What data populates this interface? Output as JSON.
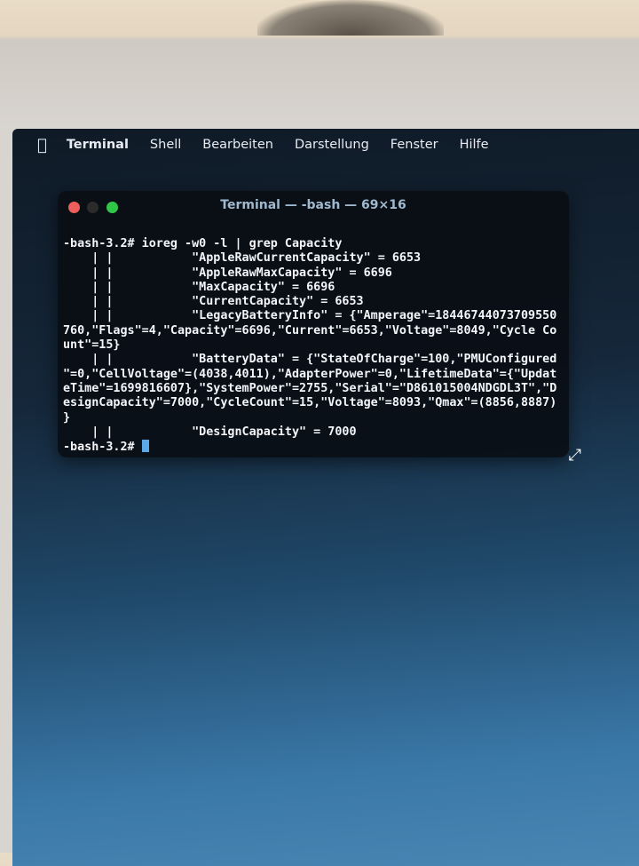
{
  "menubar": {
    "items": [
      "Terminal",
      "Shell",
      "Bearbeiten",
      "Darstellung",
      "Fenster",
      "Hilfe"
    ]
  },
  "window": {
    "title": "Terminal — -bash — 69×16",
    "traffic_lights": {
      "close": "#ec5f5a",
      "minimize": "#2b2b2b",
      "zoom": "#30c748"
    }
  },
  "terminal": {
    "lines": [
      "-bash-3.2# ioreg -w0 -l | grep Capacity",
      "    | |           \"AppleRawCurrentCapacity\" = 6653",
      "    | |           \"AppleRawMaxCapacity\" = 6696",
      "    | |           \"MaxCapacity\" = 6696",
      "    | |           \"CurrentCapacity\" = 6653",
      "    | |           \"LegacyBatteryInfo\" = {\"Amperage\"=18446744073709550",
      "760,\"Flags\"=4,\"Capacity\"=6696,\"Current\"=6653,\"Voltage\"=8049,\"Cycle Co",
      "unt\"=15}",
      "    | |           \"BatteryData\" = {\"StateOfCharge\"=100,\"PMUConfigured",
      "\"=0,\"CellVoltage\"=(4038,4011),\"AdapterPower\"=0,\"LifetimeData\"={\"Updat",
      "eTime\"=1699816607},\"SystemPower\"=2755,\"Serial\"=\"D861015004NDGDL3T\",\"D",
      "esignCapacity\"=7000,\"CycleCount\"=15,\"Voltage\"=8093,\"Qmax\"=(8856,8887)",
      "}",
      "    | |           \"DesignCapacity\" = 7000"
    ],
    "prompt": "-bash-3.2# "
  }
}
